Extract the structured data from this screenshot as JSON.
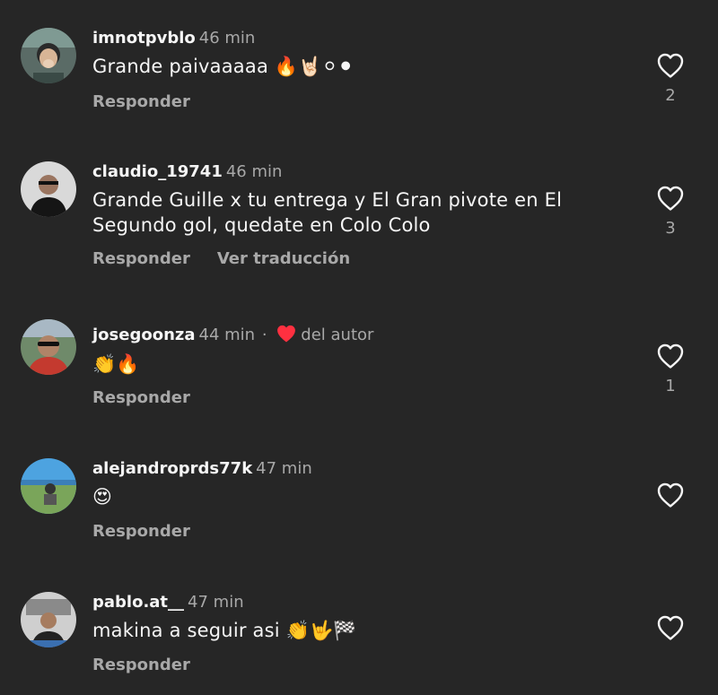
{
  "comments": [
    {
      "username": "imnotpvblo",
      "time": "46 min",
      "text": "Grande paivaaaaa 🔥🤘🏻⚪⚫",
      "reply_label": "Responder",
      "likes": "2"
    },
    {
      "username": "claudio_19741",
      "time": "46 min",
      "text": "Grande Guille x tu entrega y El Gran pivote en El Segundo gol, quedate en Colo Colo",
      "reply_label": "Responder",
      "translate_label": "Ver traducción",
      "likes": "3"
    },
    {
      "username": "josegoonza",
      "time": "44 min",
      "separator": "·",
      "liked_by_author": "del autor",
      "text": "👏🔥",
      "reply_label": "Responder",
      "likes": "1"
    },
    {
      "username": "alejandroprds77k",
      "time": "47 min",
      "text": "😍",
      "reply_label": "Responder"
    },
    {
      "username": "pablo.at__",
      "time": "47 min",
      "text": "makina a seguir asi 👏🤟🏁",
      "reply_label": "Responder"
    }
  ],
  "icons": {
    "like": "heart-outline-icon",
    "author_like": "heart-filled-icon"
  },
  "colors": {
    "background": "#262626",
    "primary_text": "#f5f5f5",
    "secondary_text": "#a8a8a8",
    "author_heart": "#ff3040"
  }
}
